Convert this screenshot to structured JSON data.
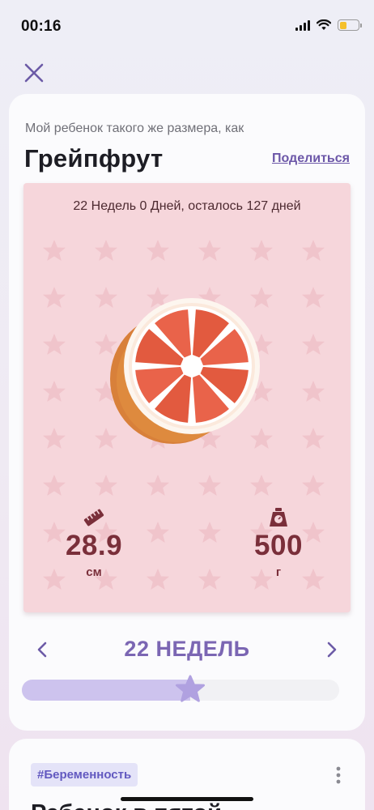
{
  "status": {
    "time": "00:16"
  },
  "header": {
    "close_icon": "close-icon"
  },
  "size_card": {
    "subtitle": "Мой ребенок такого же размера, как",
    "fruit_name": "Грейпфрут",
    "share_label": "Поделиться",
    "week_info": "22 Недель 0 Дней, осталось 127 дней",
    "fruit_icon": "grapefruit-illustration",
    "length": {
      "icon": "ruler-icon",
      "value": "28.9",
      "unit": "см"
    },
    "weight": {
      "icon": "scale-icon",
      "value": "500",
      "unit": "г"
    }
  },
  "week_nav": {
    "label": "22 НЕДЕЛЬ",
    "prev_icon": "chevron-left-icon",
    "next_icon": "chevron-right-icon"
  },
  "progress": {
    "fraction": 0.53,
    "colors": {
      "fill": "#cdc3ee",
      "track": "#f1f1f4",
      "star": "#b0a1e0"
    }
  },
  "article_card": {
    "tag": "#Беременность",
    "more_icon": "more-vertical-icon",
    "title_peek": "Ребенок в пятой"
  },
  "colors": {
    "accent": "#7b66b3",
    "panel": "#f6d6db",
    "metric": "#7a2f3a"
  }
}
